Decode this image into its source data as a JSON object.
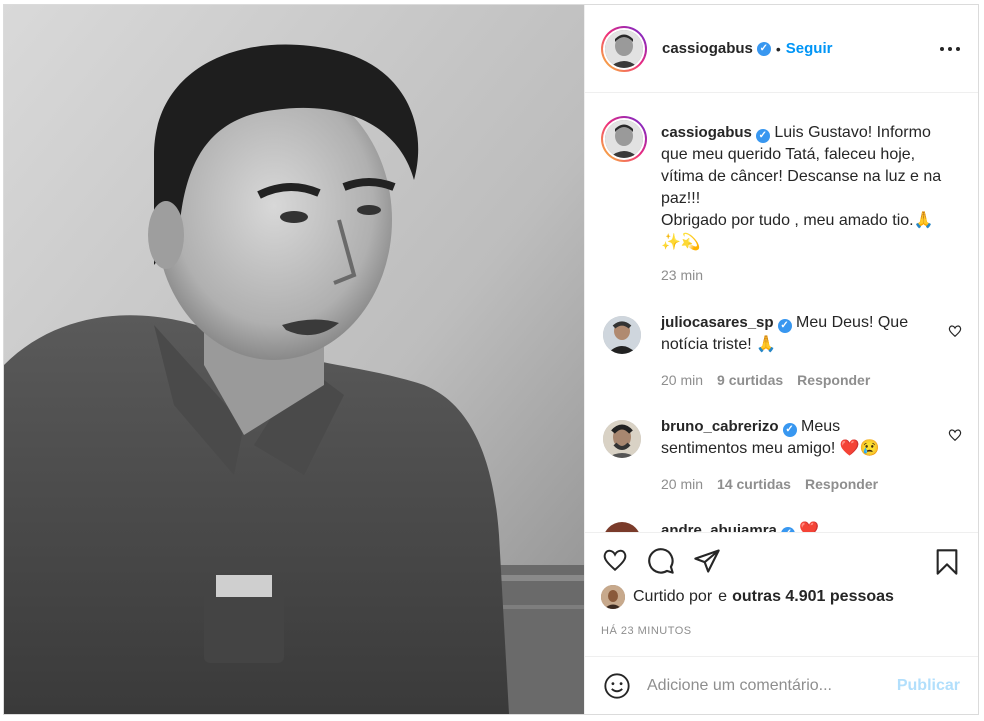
{
  "post": {
    "photo_alt": "foto",
    "header": {
      "username": "cassiogabus",
      "separator": "•",
      "follow_label": "Seguir"
    },
    "caption": {
      "username": "cassiogabus",
      "text_lines": [
        "Luis Gustavo! Informo",
        "que meu querido Tatá, faleceu hoje,",
        "vítima de câncer! Descanse na luz e na",
        "paz!!!",
        "Obrigado por tudo , meu amado tio.🙏",
        "✨💫"
      ],
      "time": "23 min"
    },
    "comments": [
      {
        "username": "juliocasares_sp",
        "text_1": "Meu Deus! Que",
        "text_2": "notícia triste! 🙏",
        "time": "20 min",
        "likes": "9 curtidas",
        "reply": "Responder"
      },
      {
        "username": "bruno_cabrerizo",
        "text_1": "Meus",
        "text_2": "sentimentos meu amigo! ❤️😢",
        "time": "20 min",
        "likes": "14 curtidas",
        "reply": "Responder"
      },
      {
        "username": "andre_abujamra",
        "text_1": "❤️"
      }
    ],
    "likes": {
      "liked_by": "Curtido por",
      "and": "e",
      "others": "outras 4.901 pessoas"
    },
    "time_ago": "HÁ 23 MINUTOS",
    "comment_input": {
      "placeholder": "Adicione um comentário...",
      "publish_label": "Publicar"
    },
    "icons": {
      "like": "heart-icon",
      "comment": "comment-icon",
      "share": "share-icon",
      "save": "bookmark-icon",
      "emoji": "emoji-icon",
      "more": "more-options-icon"
    },
    "colors": {
      "accent": "#0095f6",
      "publish_disabled": "#b2dffc",
      "verified": "#3897f0",
      "muted": "#8e8e8e"
    }
  }
}
